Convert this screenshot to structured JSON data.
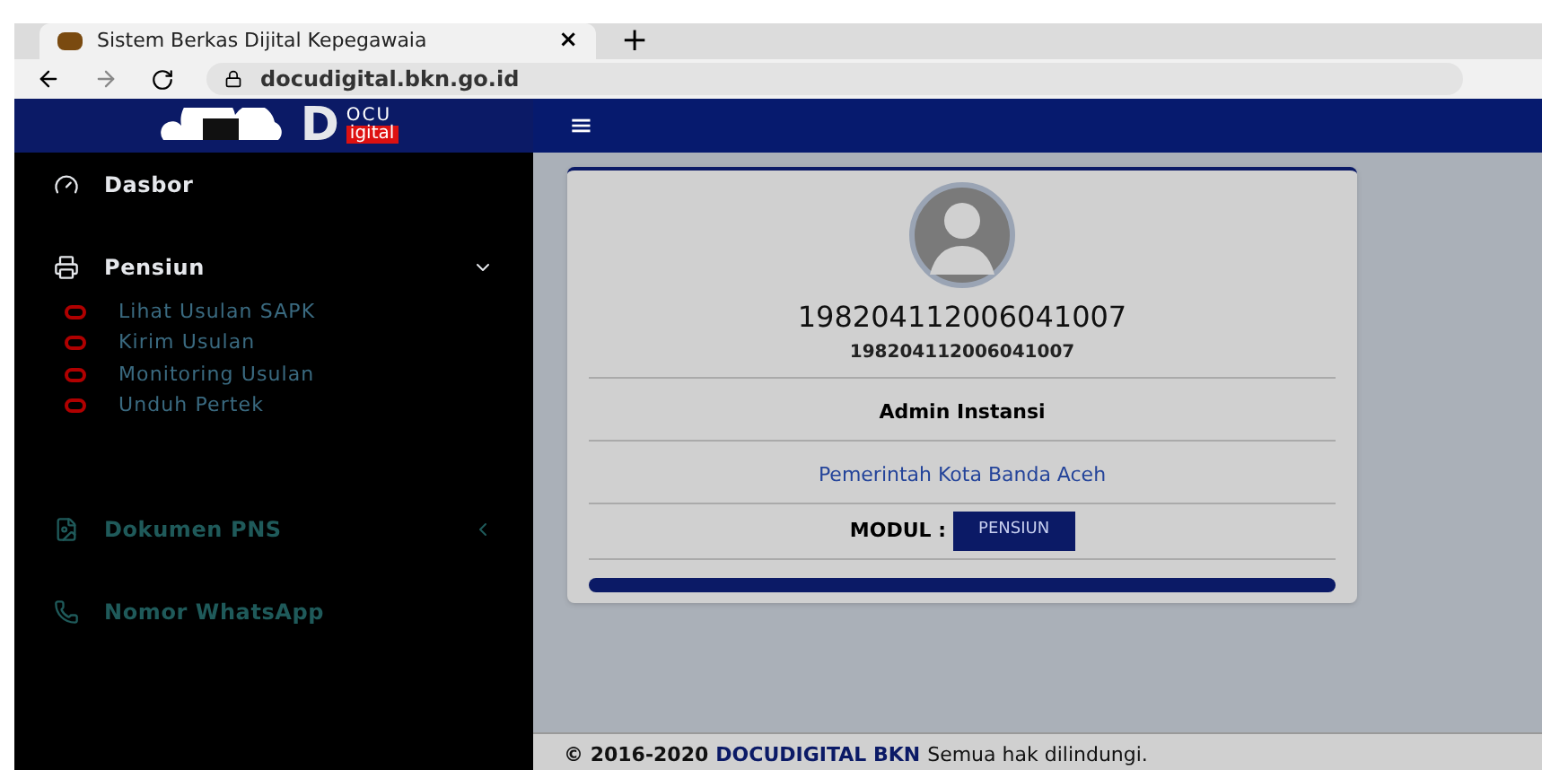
{
  "browser": {
    "tab_title": "Sistem Berkas Dijital Kepegawaia",
    "tab_close": "×",
    "new_tab": "+",
    "url": "docudigital.bkn.go.id"
  },
  "header": {
    "logo": {
      "big": "D",
      "top": "OCU",
      "bottom": "igital"
    },
    "menu_glyph": "≡"
  },
  "sidebar": {
    "items": [
      {
        "label": "Dasbor",
        "highlighted": true
      },
      {
        "label": "Pensiun",
        "highlighted": true,
        "expanded": true,
        "children": [
          {
            "label": "Lihat Usulan SAPK"
          },
          {
            "label": "Kirim Usulan"
          },
          {
            "label": "Monitoring Usulan"
          },
          {
            "label": "Unduh Pertek"
          }
        ]
      },
      {
        "label": "Dokumen PNS",
        "highlighted": false,
        "expanded": false
      },
      {
        "label": "Nomor WhatsApp",
        "highlighted": false
      }
    ]
  },
  "profile": {
    "name": "198204112006041007",
    "id": "198204112006041007",
    "role": "Admin Instansi",
    "agency": "Pemerintah Kota Banda Aceh",
    "module_label": "MODUL :",
    "module": "PENSIUN"
  },
  "footer": {
    "copyright": "© 2016-2020",
    "brand": "DOCUDIGITAL BKN",
    "rights": "Semua hak dilindungi."
  }
}
